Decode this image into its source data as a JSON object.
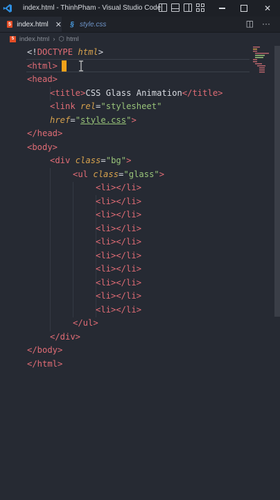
{
  "titlebar": {
    "title": "index.html - ThinhPham - Visual Studio Code"
  },
  "tabs": [
    {
      "label": "index.html",
      "icon": "html5-icon"
    },
    {
      "label": "style.css",
      "icon": "css-icon"
    }
  ],
  "breadcrumb": {
    "file": "index.html",
    "element": "html"
  },
  "colors": {
    "tag": "#e06c75",
    "attribute": "#d6a14d",
    "string": "#98c379",
    "text": "#d7dae0",
    "cursor": "#f2a21a",
    "background": "#262a33"
  },
  "code": {
    "l1": {
      "open": "<!",
      "kw": "DOCTYPE",
      "sp": " ",
      "name": "html",
      "close": ">"
    },
    "l2": {
      "tag": "<html>"
    },
    "l3": {
      "tag": "<head>"
    },
    "l4": {
      "o": "<title>",
      "text": "CSS Glass Animation",
      "c": "</title>"
    },
    "l5": {
      "o": "<link",
      "sp": " ",
      "attr": "rel",
      "eq": "=",
      "val": "\"stylesheet\""
    },
    "l6": {
      "attr": "href",
      "eq": "=",
      "q1": "\"",
      "val": "style.css",
      "q2": "\"",
      "c": ">"
    },
    "l7": {
      "tag": "</head>"
    },
    "l8": {
      "tag": "<body>"
    },
    "l9": {
      "o": "<div",
      "sp": " ",
      "attr": "class",
      "eq": "=",
      "val": "\"bg\"",
      "c": ">"
    },
    "l10": {
      "o": "<ul",
      "sp": " ",
      "attr": "class",
      "eq": "=",
      "val": "\"glass\"",
      "c": ">"
    },
    "li": "<li></li>",
    "l21": {
      "tag": "</ul>"
    },
    "l22": {
      "tag": "</div>"
    },
    "l23": {
      "tag": "</body>"
    },
    "l24": {
      "tag": "</html>"
    }
  }
}
